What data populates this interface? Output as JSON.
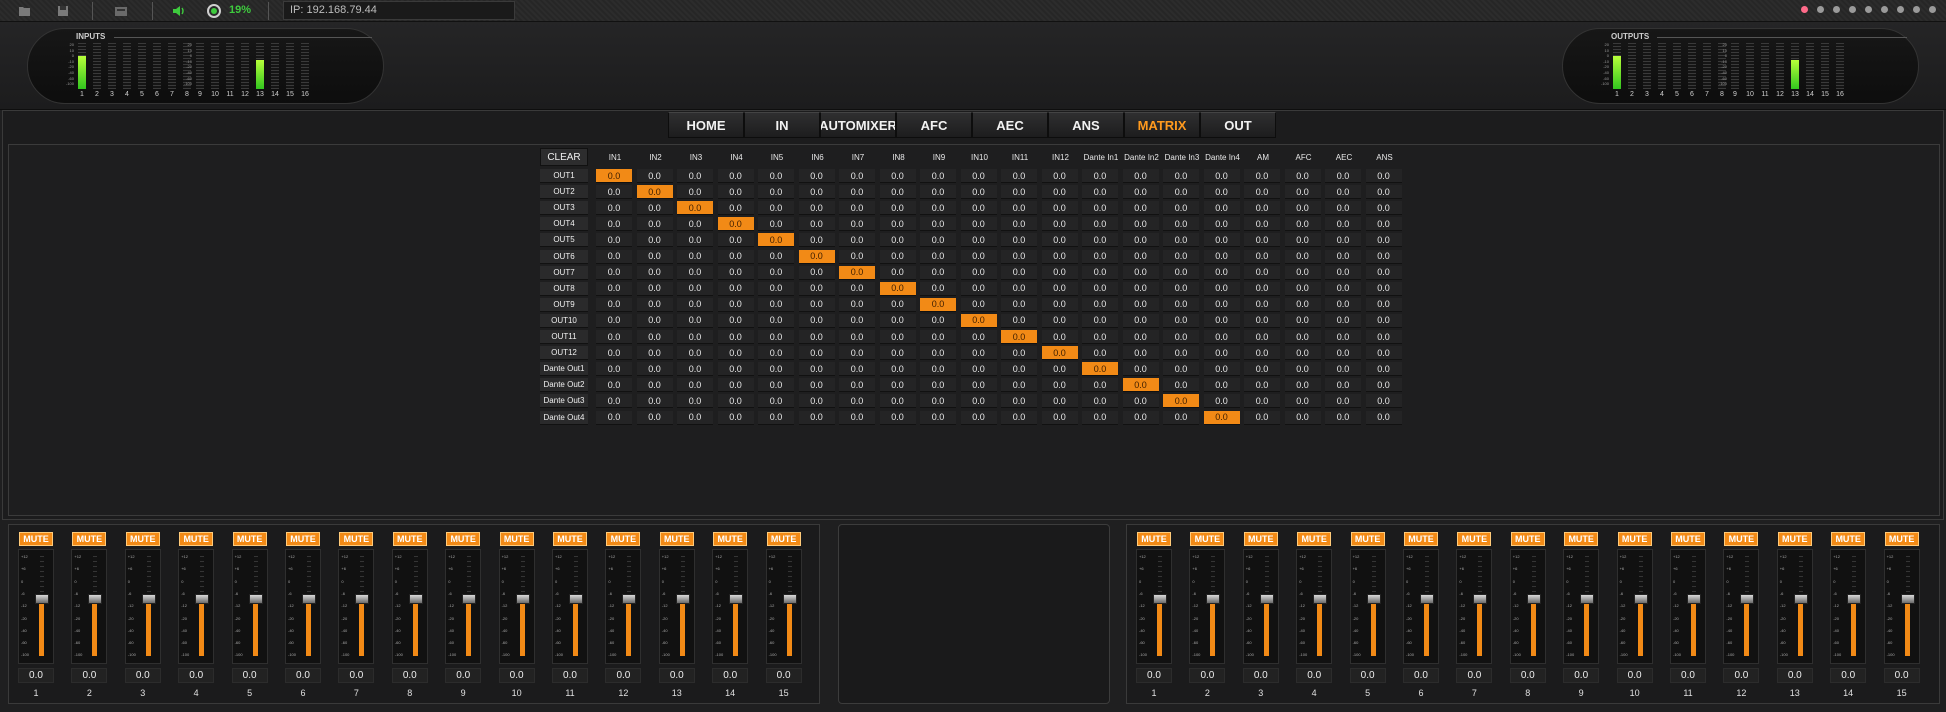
{
  "toolbar": {
    "percent": "19%",
    "ip_label": "IP: 192.168.79.44",
    "icons": [
      "folder-open-icon",
      "save-icon",
      "export-icon",
      "speaker-icon",
      "cpu-icon"
    ],
    "window_dots": 9
  },
  "meters": {
    "inputs_title": "INPUTS",
    "outputs_title": "OUTPUTS",
    "scale": [
      "20",
      "10",
      "0",
      "-10",
      "-20",
      "-40",
      "-60",
      "-100"
    ],
    "channels": [
      "1",
      "2",
      "3",
      "4",
      "5",
      "6",
      "7",
      "8",
      "9",
      "10",
      "11",
      "12",
      "13",
      "14",
      "15",
      "16"
    ],
    "input_levels": [
      0.72,
      0,
      0,
      0,
      0,
      0,
      0,
      0,
      0,
      0,
      0,
      0,
      0.62,
      0,
      0,
      0
    ],
    "output_levels": [
      0.72,
      0,
      0,
      0,
      0,
      0,
      0,
      0,
      0,
      0,
      0,
      0,
      0.62,
      0,
      0,
      0
    ]
  },
  "tabs": [
    {
      "label": "HOME",
      "active": false
    },
    {
      "label": "IN",
      "active": false
    },
    {
      "label": "AUTOMIXER",
      "active": false
    },
    {
      "label": "AFC",
      "active": false
    },
    {
      "label": "AEC",
      "active": false
    },
    {
      "label": "ANS",
      "active": false
    },
    {
      "label": "MATRIX",
      "active": true
    },
    {
      "label": "OUT",
      "active": false
    }
  ],
  "matrix": {
    "clear_label": "CLEAR",
    "columns": [
      "IN1",
      "IN2",
      "IN3",
      "IN4",
      "IN5",
      "IN6",
      "IN7",
      "IN8",
      "IN9",
      "IN10",
      "IN11",
      "IN12",
      "Dante In1",
      "Dante In2",
      "Dante In3",
      "Dante In4",
      "AM",
      "AFC",
      "AEC",
      "ANS"
    ],
    "rows": [
      "OUT1",
      "OUT2",
      "OUT3",
      "OUT4",
      "OUT5",
      "OUT6",
      "OUT7",
      "OUT8",
      "OUT9",
      "OUT10",
      "OUT11",
      "OUT12",
      "Dante Out1",
      "Dante Out2",
      "Dante Out3",
      "Dante Out4"
    ],
    "cell_value": "0.0",
    "active_cells": [
      [
        0,
        0
      ],
      [
        1,
        1
      ],
      [
        2,
        2
      ],
      [
        3,
        3
      ],
      [
        4,
        4
      ],
      [
        5,
        5
      ],
      [
        6,
        6
      ],
      [
        7,
        7
      ],
      [
        8,
        8
      ],
      [
        9,
        9
      ],
      [
        10,
        10
      ],
      [
        11,
        11
      ],
      [
        12,
        12
      ],
      [
        13,
        13
      ],
      [
        14,
        14
      ],
      [
        15,
        15
      ]
    ]
  },
  "faders": {
    "mute_label": "MUTE",
    "scale": [
      "+12",
      "+6",
      "0",
      "-6",
      "-12",
      "-20",
      "-40",
      "-60",
      "-100"
    ],
    "value": "0.0",
    "level": 0.52,
    "left_bank": [
      "1",
      "2",
      "3",
      "4",
      "5",
      "6",
      "7",
      "8",
      "9",
      "10",
      "11",
      "12",
      "13",
      "14",
      "15"
    ],
    "right_bank": [
      "1",
      "2",
      "3",
      "4",
      "5",
      "6",
      "7",
      "8",
      "9",
      "10",
      "11",
      "12",
      "13",
      "14",
      "15"
    ]
  },
  "colors": {
    "accent": "#f28a16",
    "meter_green": "#32c51f",
    "active_tab": "#ff9a1e"
  }
}
